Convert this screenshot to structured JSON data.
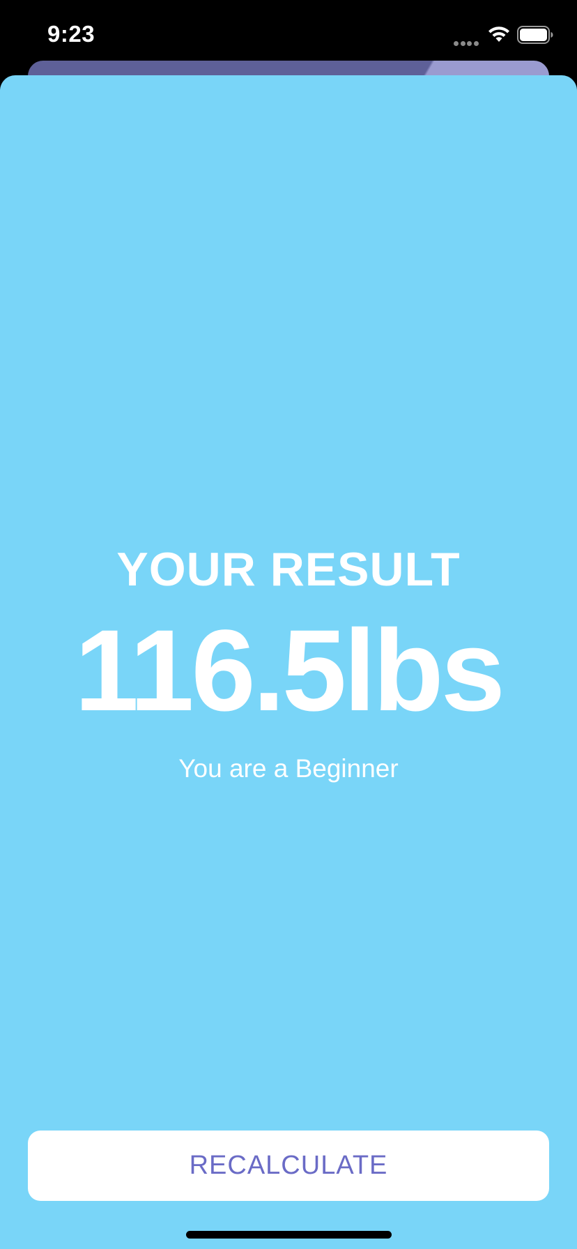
{
  "status_bar": {
    "time": "9:23",
    "signal_icon": "cellular-dots-icon",
    "wifi_icon": "wifi-icon",
    "battery_icon": "battery-icon"
  },
  "result": {
    "title": "YOUR RESULT",
    "value": "116.5lbs",
    "message": "You are a Beginner"
  },
  "actions": {
    "recalculate_label": "RECALCULATE"
  },
  "colors": {
    "background": "#79d5f8",
    "button_text": "#6a6bc6",
    "button_background": "#ffffff",
    "behind_sheet": "#5e6098"
  }
}
